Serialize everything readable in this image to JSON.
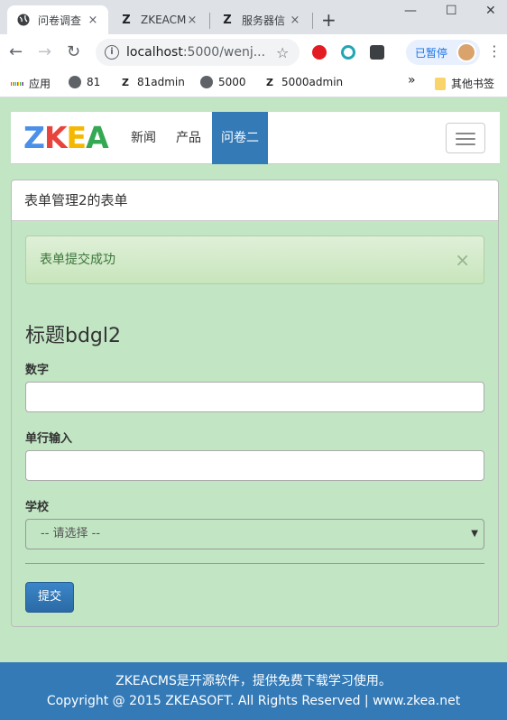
{
  "browser": {
    "tabs": [
      {
        "title": "问卷调查",
        "close": "×"
      },
      {
        "title": "ZKEACMS",
        "close": "×"
      },
      {
        "title": "服务器信",
        "close": "×"
      }
    ],
    "new_tab": "+",
    "window_controls": {
      "minimize": "—",
      "maximize": "☐",
      "close": "✕"
    },
    "url_host": "localhost",
    "url_rest": ":5000/wenj...",
    "paused_label": "已暂停",
    "bookmarks": [
      "应用",
      "81",
      "81admin",
      "5000",
      "5000admin"
    ],
    "bookmarks_more": "»",
    "other_bookmarks": "其他书签"
  },
  "site": {
    "logo_letters": [
      "Z",
      "K",
      "E",
      "A"
    ],
    "logo_colors": [
      "#4a8fe8",
      "#e8433c",
      "#f5b800",
      "#34a853"
    ],
    "nav": [
      {
        "label": "新闻",
        "active": false
      },
      {
        "label": "产品",
        "active": false
      },
      {
        "label": "问卷二",
        "active": true
      }
    ]
  },
  "panel": {
    "heading": "表单管理2的表单",
    "alert": "表单提交成功",
    "alert_close": "×",
    "form_title": "标题bdgl2",
    "fields": [
      {
        "label": "数字",
        "value": ""
      },
      {
        "label": "单行输入",
        "value": ""
      }
    ],
    "select_label": "学校",
    "select_value": "-- 请选择 --",
    "submit_label": "提交"
  },
  "footer": {
    "line1": "ZKEACMS是开源软件，提供免费下载学习使用。",
    "line2": "Copyright @ 2015 ZKEASOFT. All Rights Reserved | www.zkea.net"
  }
}
